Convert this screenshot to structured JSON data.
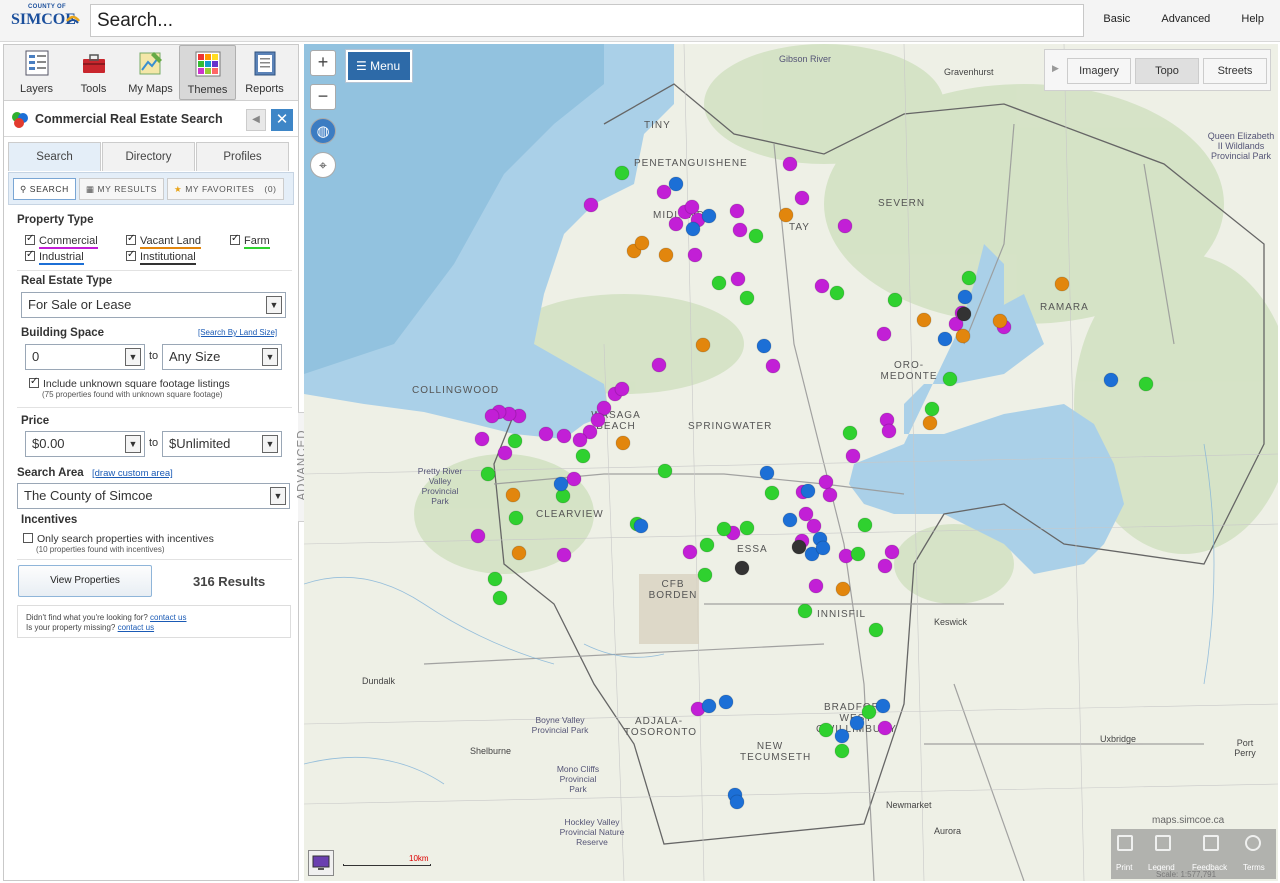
{
  "header": {
    "logo_text_small": "COUNTY OF",
    "logo_text": "SIMCOE",
    "search_placeholder": "Search...",
    "links": [
      "Basic",
      "Advanced",
      "Help"
    ]
  },
  "toolbar": {
    "items": [
      {
        "label": "Layers",
        "icon": "layers-icon"
      },
      {
        "label": "Tools",
        "icon": "toolbox-icon"
      },
      {
        "label": "My Maps",
        "icon": "my-maps-icon"
      },
      {
        "label": "Themes",
        "icon": "themes-icon",
        "active": true
      },
      {
        "label": "Reports",
        "icon": "reports-icon"
      }
    ]
  },
  "panel": {
    "title": "Commercial Real Estate Search",
    "tabs": [
      "Search",
      "Directory",
      "Profiles"
    ],
    "subtabs": {
      "search": "SEARCH",
      "results": "MY RESULTS",
      "favorites": "MY FAVORITES",
      "favorites_count": "(0)"
    },
    "property_type": {
      "label": "Property Type",
      "options": [
        {
          "label": "Commercial",
          "checked": true,
          "color": "#c21fd6"
        },
        {
          "label": "Vacant Land",
          "checked": true,
          "color": "#e2860d"
        },
        {
          "label": "Farm",
          "checked": true,
          "color": "#2fd12f"
        },
        {
          "label": "Industrial",
          "checked": true,
          "color": "#1c6fd6"
        },
        {
          "label": "Institutional",
          "checked": true,
          "color": "#333333"
        }
      ]
    },
    "real_estate_type": {
      "label": "Real Estate Type",
      "value": "For Sale or Lease"
    },
    "building_space": {
      "label": "Building Space",
      "link": "[Search By Land Size]",
      "min": "0",
      "to": "to",
      "max": "Any Size",
      "unknown_label": "Include unknown square footage listings",
      "unknown_note": "(75 properties found with unknown square footage)"
    },
    "price": {
      "label": "Price",
      "min": "$0.00",
      "to": "to",
      "max": "$Unlimited"
    },
    "search_area": {
      "label": "Search Area",
      "link": "[draw custom area]",
      "value": "The County of Simcoe"
    },
    "incentives": {
      "label": "Incentives",
      "option": "Only search properties with incentives",
      "note": "(10 properties found with incentives)"
    },
    "view_button": "View Properties",
    "results": "316 Results",
    "footer1": "Didn't find what you're looking for?",
    "footer1_link": "contact us",
    "footer2": "Is your property missing?",
    "footer2_link": "contact us"
  },
  "map": {
    "menu": "Menu",
    "advanced": "ADVANCED",
    "basemaps": [
      "Imagery",
      "Topo",
      "Streets"
    ],
    "active_basemap": "Topo",
    "place_labels": [
      "TINY",
      "PENETANGUISHENE",
      "MIDLAND",
      "TAY",
      "SEVERN",
      "ORO-MEDONTE",
      "RAMARA",
      "COLLINGWOOD",
      "WASAGA BEACH",
      "SPRINGWATER",
      "CLEARVIEW",
      "ESSA",
      "CFB BORDEN",
      "INNISFIL",
      "ADJALA-TOSORONTO",
      "NEW TECUMSETH",
      "BRADFORD WEST GWILLIMBURY",
      "Gravenhurst",
      "Queen Elizabeth II Wildlands Provincial Park",
      "Dundalk",
      "Shelburne",
      "Newmarket",
      "Aurora",
      "Uxbridge",
      "Port Perry",
      "Keswick",
      "Pretty River Valley Provincial Park",
      "Boyne Valley Provincial Park",
      "Mono Cliffs Provincial Park",
      "Hockley Valley Provincial Nature Reserve",
      "Gibson River"
    ],
    "scale_label": "10km",
    "watermark": "maps.simcoe.ca",
    "tools": [
      "Print",
      "Legend",
      "Feedback",
      "Terms"
    ],
    "scale_text": "Scale: 1:577,791"
  }
}
